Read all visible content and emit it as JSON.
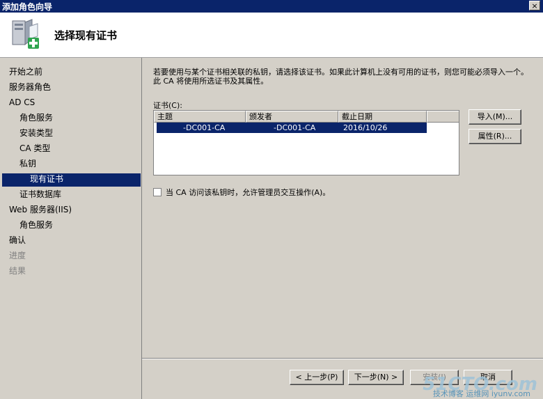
{
  "window": {
    "title": "添加角色向导",
    "close_glyph": "×"
  },
  "header": {
    "title": "选择现有证书"
  },
  "nav": {
    "items": [
      {
        "label": "开始之前",
        "state": "normal"
      },
      {
        "label": "服务器角色",
        "state": "normal"
      },
      {
        "label": "AD CS",
        "state": "normal"
      },
      {
        "label": "角色服务",
        "state": "normal"
      },
      {
        "label": "安装类型",
        "state": "normal"
      },
      {
        "label": "CA 类型",
        "state": "normal"
      },
      {
        "label": "私钥",
        "state": "normal"
      },
      {
        "label": "现有证书",
        "state": "selected"
      },
      {
        "label": "证书数据库",
        "state": "normal"
      },
      {
        "label": "Web 服务器(IIS)",
        "state": "normal"
      },
      {
        "label": "角色服务",
        "state": "normal"
      },
      {
        "label": "确认",
        "state": "normal"
      },
      {
        "label": "进度",
        "state": "disabled"
      },
      {
        "label": "结果",
        "state": "disabled"
      }
    ]
  },
  "content": {
    "description": "若要使用与某个证书相关联的私钥，请选择该证书。如果此计算机上没有可用的证书，则您可能必须导入一个。此 CA 将使用所选证书及其属性。",
    "certs_label": "证书(C):",
    "columns": [
      "主题",
      "颁发者",
      "截止日期"
    ],
    "rows": [
      {
        "subject": "-DC001-CA",
        "issuer": "-DC001-CA",
        "expires": "2016/10/26"
      }
    ],
    "import_button": "导入(M)...",
    "properties_button": "属性(R)...",
    "checkbox_label": "当 CA 访问该私钥时，允许管理员交互操作(A)。",
    "checkbox_checked": false
  },
  "footer": {
    "prev_button": "< 上一步(P)",
    "next_button": "下一步(N) >",
    "install_button": "安装(I)",
    "cancel_button": "取消"
  },
  "watermark": {
    "line1": "51CTO.com",
    "line2": "技术博客 运维网 iyunv.com"
  }
}
